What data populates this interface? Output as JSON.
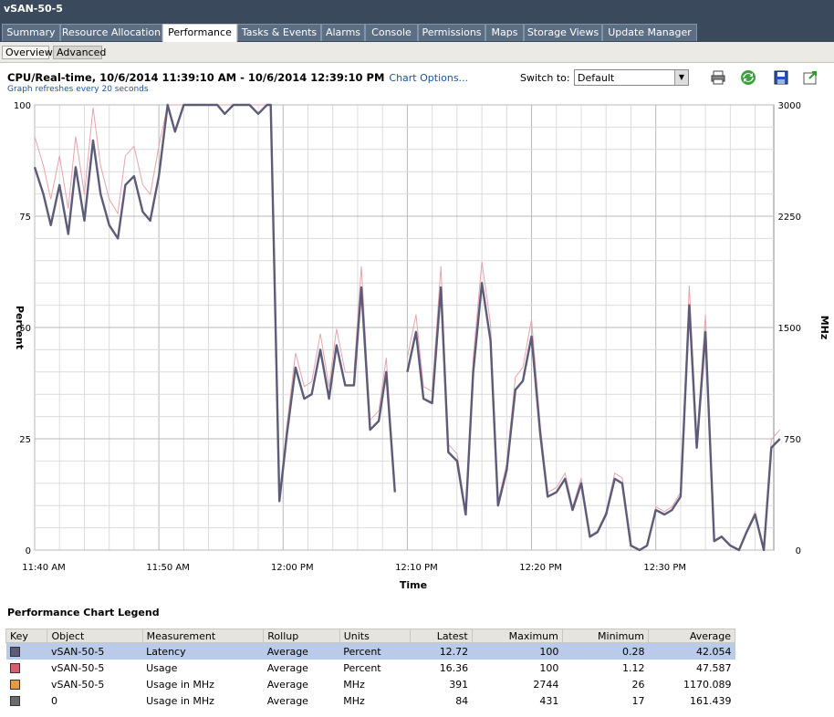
{
  "window": {
    "title": "vSAN-50-5"
  },
  "tabs": [
    {
      "label": "Summary"
    },
    {
      "label": "Resource Allocation"
    },
    {
      "label": "Performance"
    },
    {
      "label": "Tasks & Events"
    },
    {
      "label": "Alarms"
    },
    {
      "label": "Console"
    },
    {
      "label": "Permissions"
    },
    {
      "label": "Maps"
    },
    {
      "label": "Storage Views"
    },
    {
      "label": "Update Manager"
    }
  ],
  "subtabs": [
    {
      "label": "Overview"
    },
    {
      "label": "Advanced"
    }
  ],
  "header": {
    "title": "CPU/Real-time, 10/6/2014 11:39:10 AM - 10/6/2014 12:39:10 PM",
    "chart_options": "Chart Options...",
    "refresh_note": "Graph refreshes every 20 seconds",
    "switch_label": "Switch to:",
    "switch_value": "Default"
  },
  "toolbar_icons": [
    "print-icon",
    "refresh-icon",
    "save-icon",
    "export-icon"
  ],
  "chart_data": {
    "type": "line",
    "xlabel": "Time",
    "ylabel": "Percent",
    "y2label": "MHz",
    "x_ticks": [
      "11:40 AM",
      "11:50 AM",
      "12:00 PM",
      "12:10 PM",
      "12:20 PM",
      "12:30 PM"
    ],
    "y_ticks": [
      "0",
      "25",
      "50",
      "75",
      "100"
    ],
    "y2_ticks": [
      "0",
      "750",
      "1500",
      "2250",
      "3000"
    ],
    "ylim": [
      0,
      100
    ],
    "y2lim": [
      0,
      3000
    ],
    "xlim_minutes": [
      0,
      60
    ],
    "grid": true,
    "series": [
      {
        "name": "Latency",
        "color": "#5c5b78",
        "values": [
          [
            0,
            86
          ],
          [
            0.7,
            80
          ],
          [
            1.3,
            73
          ],
          [
            2,
            82
          ],
          [
            2.7,
            71
          ],
          [
            3.3,
            86
          ],
          [
            4,
            74
          ],
          [
            4.7,
            92
          ],
          [
            5.3,
            80
          ],
          [
            6,
            73
          ],
          [
            6.7,
            70
          ],
          [
            7.3,
            82
          ],
          [
            8,
            84
          ],
          [
            8.7,
            76
          ],
          [
            9.3,
            74
          ],
          [
            10,
            84
          ],
          [
            10.7,
            100
          ],
          [
            11.3,
            94
          ],
          [
            12,
            100
          ],
          [
            12.7,
            100
          ],
          [
            13.3,
            100
          ],
          [
            14,
            100
          ],
          [
            14.7,
            100
          ],
          [
            15.3,
            98
          ],
          [
            16,
            100
          ],
          [
            16.7,
            100
          ],
          [
            17.3,
            100
          ],
          [
            18,
            98
          ],
          [
            18.7,
            100
          ],
          [
            19,
            100
          ],
          [
            19.7,
            11
          ],
          [
            20.3,
            26
          ],
          [
            21,
            41
          ],
          [
            21.7,
            34
          ],
          [
            22.3,
            35
          ],
          [
            23,
            45
          ],
          [
            23.7,
            34
          ],
          [
            24.3,
            46
          ],
          [
            25,
            37
          ],
          [
            25.7,
            37
          ],
          [
            26.3,
            59
          ],
          [
            27,
            27
          ],
          [
            27.7,
            29
          ],
          [
            28.3,
            40
          ],
          [
            29,
            13
          ]
        ]
      },
      {
        "name": "Latency (cont.)",
        "color": "#5c5b78",
        "values": [
          [
            30,
            40
          ],
          [
            30.7,
            49
          ],
          [
            31.3,
            34
          ],
          [
            32,
            33
          ],
          [
            32.7,
            59
          ],
          [
            33.3,
            22
          ],
          [
            34,
            20
          ],
          [
            34.7,
            8
          ],
          [
            35.3,
            40
          ],
          [
            36,
            60
          ],
          [
            36.7,
            47
          ],
          [
            37.3,
            10
          ],
          [
            38,
            18
          ],
          [
            38.7,
            36
          ],
          [
            39.3,
            38
          ],
          [
            40,
            48
          ],
          [
            40.7,
            26
          ],
          [
            41.3,
            12
          ],
          [
            42,
            13
          ],
          [
            42.7,
            16
          ],
          [
            43.3,
            9
          ],
          [
            44,
            15
          ],
          [
            44.7,
            3
          ],
          [
            45.3,
            4
          ],
          [
            46,
            8
          ],
          [
            46.7,
            16
          ],
          [
            47.3,
            15
          ],
          [
            48,
            1
          ],
          [
            48.7,
            0
          ],
          [
            49.3,
            1
          ],
          [
            50,
            9
          ],
          [
            50.7,
            8
          ],
          [
            51.3,
            9
          ],
          [
            52,
            12
          ],
          [
            52.7,
            55
          ],
          [
            53.3,
            23
          ],
          [
            54,
            49
          ],
          [
            54.7,
            2
          ],
          [
            55.3,
            3
          ],
          [
            56,
            1
          ],
          [
            56.7,
            0
          ],
          [
            57.3,
            4
          ],
          [
            58,
            8
          ],
          [
            58.7,
            0
          ],
          [
            59.3,
            23
          ],
          [
            60,
            25
          ]
        ]
      }
    ],
    "legend_title": "Performance Chart Legend",
    "legend": {
      "columns": [
        "Key",
        "Object",
        "Measurement",
        "Rollup",
        "Units",
        "Latest",
        "Maximum",
        "Minimum",
        "Average"
      ],
      "rows": [
        {
          "color": "#5c5b78",
          "object": "vSAN-50-5",
          "measurement": "Latency",
          "rollup": "Average",
          "units": "Percent",
          "latest": "12.72",
          "maximum": "100",
          "minimum": "0.28",
          "average": "42.054"
        },
        {
          "color": "#d35f70",
          "object": "vSAN-50-5",
          "measurement": "Usage",
          "rollup": "Average",
          "units": "Percent",
          "latest": "16.36",
          "maximum": "100",
          "minimum": "1.12",
          "average": "47.587"
        },
        {
          "color": "#e09a4a",
          "object": "vSAN-50-5",
          "measurement": "Usage in MHz",
          "rollup": "Average",
          "units": "MHz",
          "latest": "391",
          "maximum": "2744",
          "minimum": "26",
          "average": "1170.089"
        },
        {
          "color": "#6b6b6b",
          "object": "0",
          "measurement": "Usage in MHz",
          "rollup": "Average",
          "units": "MHz",
          "latest": "84",
          "maximum": "431",
          "minimum": "17",
          "average": "161.439"
        }
      ]
    }
  }
}
